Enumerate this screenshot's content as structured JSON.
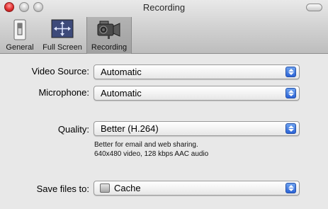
{
  "window": {
    "title": "Recording"
  },
  "tabs": [
    {
      "label": "General",
      "icon": "switch-icon"
    },
    {
      "label": "Full Screen",
      "icon": "full-screen-icon"
    },
    {
      "label": "Recording",
      "icon": "video-camera-icon",
      "selected": true
    }
  ],
  "form": {
    "video_source": {
      "label": "Video Source:",
      "value": "Automatic"
    },
    "microphone": {
      "label": "Microphone:",
      "value": "Automatic"
    },
    "quality": {
      "label": "Quality:",
      "value": "Better (H.264)",
      "description_line1": "Better for email and web sharing.",
      "description_line2": "640x480 video, 128 kbps AAC audio"
    },
    "save_files_to": {
      "label": "Save files to:",
      "value": "Cache",
      "icon": "drive-icon"
    }
  },
  "colors": {
    "accent": "#2b63d6",
    "close_button": "#e23030"
  }
}
